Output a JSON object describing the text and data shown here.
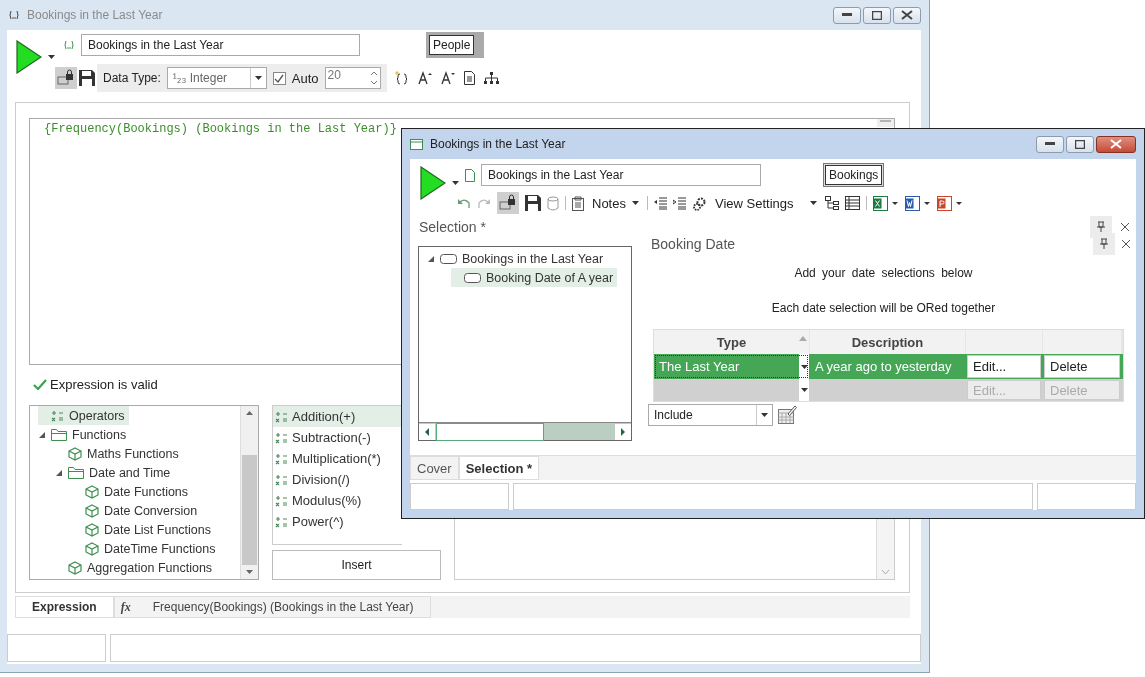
{
  "back_window": {
    "title": "Bookings in the Last Year",
    "name_field": "Bookings in the Last Year",
    "category_button": "People",
    "data_type_label": "Data Type:",
    "data_type": "¹₂₃ Integer",
    "auto": {
      "label": "Auto",
      "checked": true
    },
    "size": "20",
    "expression": "{Frequency(Bookings) (Bookings in the Last Year)}",
    "validation": {
      "text": "Expression is valid",
      "valid": true
    },
    "function_tree": [
      {
        "label": "Operators",
        "kind": "operators",
        "selected": true
      },
      {
        "label": "Functions",
        "kind": "folder",
        "selected": false,
        "expanded": true,
        "children": [
          {
            "label": "Maths Functions",
            "kind": "function",
            "selected": false
          },
          {
            "label": "Date and Time",
            "kind": "folder",
            "selected": false,
            "expanded": true,
            "children": [
              {
                "label": "Date Functions",
                "kind": "function",
                "selected": false
              },
              {
                "label": "Date Conversion",
                "kind": "function",
                "selected": false
              },
              {
                "label": "Date List Functions",
                "kind": "function",
                "selected": false
              },
              {
                "label": "DateTime Functions",
                "kind": "function",
                "selected": false
              }
            ]
          },
          {
            "label": "Aggregation Functions",
            "kind": "function",
            "selected": false
          }
        ]
      }
    ],
    "operators": [
      {
        "label": "Addition(+)",
        "selected": true
      },
      {
        "label": "Subtraction(-)",
        "selected": false
      },
      {
        "label": "Multiplication(*)",
        "selected": false
      },
      {
        "label": "Division(/)",
        "selected": false
      },
      {
        "label": "Modulus(%)",
        "selected": false
      },
      {
        "label": "Power(^)",
        "selected": false
      }
    ],
    "insert_button": "Insert",
    "tabs": [
      {
        "label": "Expression",
        "selected": true
      },
      {
        "label": "Frequency(Bookings) (Bookings in the Last Year)",
        "prefix": "fx",
        "selected": false
      }
    ]
  },
  "front_window": {
    "title": "Bookings in the Last Year",
    "name_field": "Bookings in the Last Year",
    "category_button": "Bookings",
    "notes_menu": "Notes",
    "view_settings_menu": "View Settings",
    "section_title": "Selection *",
    "tree": [
      {
        "label": "Bookings in the Last Year",
        "selected": false,
        "expanded": true,
        "children": [
          {
            "label": "Booking Date of A year",
            "selected": true
          }
        ]
      }
    ],
    "panel_title": "Booking Date",
    "instructions": [
      "Add your date selections below",
      "Each date selection will be ORed together"
    ],
    "grid": {
      "columns": [
        {
          "label": "Type",
          "sorted": true
        },
        {
          "label": "Description",
          "sorted": false
        }
      ],
      "rows": [
        {
          "type": "The Last Year",
          "description": "A year ago to yesterday",
          "edit": "Edit...",
          "delete": "Delete",
          "selected": true,
          "disabled": false
        },
        {
          "edit": "Edit...",
          "delete": "Delete",
          "selected": false,
          "disabled": true
        }
      ]
    },
    "mode_select": "Include",
    "tabs": [
      {
        "label": "Cover",
        "selected": false
      },
      {
        "label": "Selection *",
        "selected": true
      }
    ]
  }
}
